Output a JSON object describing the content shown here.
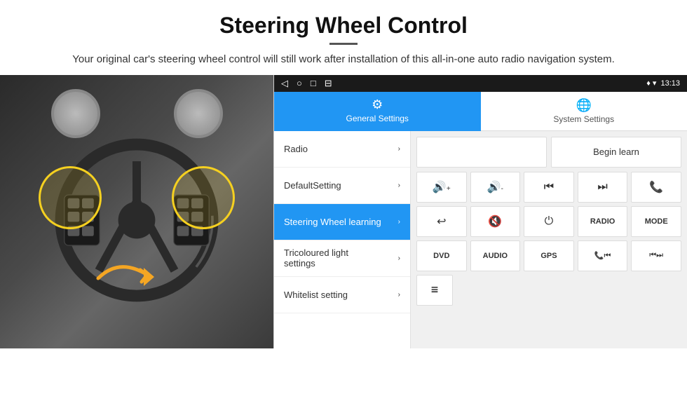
{
  "header": {
    "title": "Steering Wheel Control",
    "subtitle": "Your original car's steering wheel control will still work after installation of this all-in-one auto radio navigation system."
  },
  "status_bar": {
    "nav_icons": [
      "◁",
      "○",
      "□",
      "⊟"
    ],
    "right": "♦ ▾  13:13"
  },
  "tabs": [
    {
      "id": "general",
      "label": "General Settings",
      "icon": "⚙",
      "active": true
    },
    {
      "id": "system",
      "label": "System Settings",
      "icon": "⊕",
      "active": false
    }
  ],
  "menu_items": [
    {
      "label": "Radio",
      "active": false
    },
    {
      "label": "DefaultSetting",
      "active": false
    },
    {
      "label": "Steering Wheel learning",
      "active": true
    },
    {
      "label": "Tricoloured light settings",
      "active": false
    },
    {
      "label": "Whitelist setting",
      "active": false
    }
  ],
  "controls": {
    "begin_learn_label": "Begin learn",
    "buttons_row1": [
      "🔊+",
      "🔊-",
      "⏮",
      "⏭",
      "📞"
    ],
    "buttons_row2": [
      "↩",
      "🔇",
      "⏻",
      "RADIO",
      "MODE"
    ],
    "buttons_row3": [
      "DVD",
      "AUDIO",
      "GPS",
      "📞⏮",
      "⏮⏭"
    ],
    "bottom_icon": "≡"
  },
  "car_image": {
    "alt": "Steering wheel with highlighted control buttons"
  }
}
